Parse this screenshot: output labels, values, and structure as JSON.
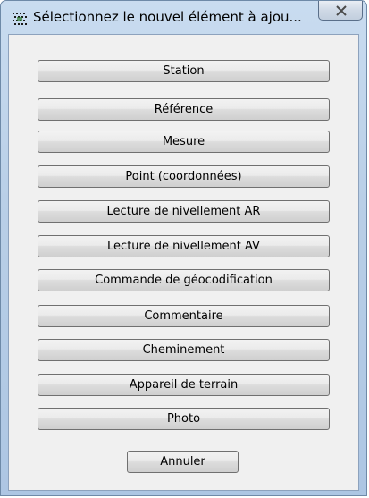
{
  "window": {
    "title": "Sélectionnez le nouvel élément à ajou..."
  },
  "buttons": [
    {
      "label": "Station"
    },
    {
      "label": "Référence"
    },
    {
      "label": "Mesure"
    },
    {
      "label": "Point (coordonnées)"
    },
    {
      "label": "Lecture de nivellement AR"
    },
    {
      "label": "Lecture de nivellement AV"
    },
    {
      "label": "Commande de géocodification"
    },
    {
      "label": "Commentaire"
    },
    {
      "label": "Cheminement"
    },
    {
      "label": "Appareil de terrain"
    },
    {
      "label": "Photo"
    }
  ],
  "cancel": {
    "label": "Annuler"
  },
  "icons": {
    "app": "dot-grid-icon",
    "close": "close-icon"
  },
  "colors": {
    "frame": "#b9cfe7",
    "client": "#f0f0f0",
    "button_border": "#707070"
  }
}
